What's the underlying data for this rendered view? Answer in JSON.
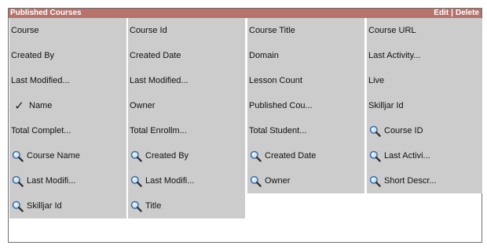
{
  "header": {
    "title": "Published Courses",
    "edit_label": "Edit",
    "separator": "|",
    "delete_label": "Delete"
  },
  "columns": [
    [
      {
        "label": "Course",
        "icon": ""
      },
      {
        "label": "Created By",
        "icon": ""
      },
      {
        "label": "Last Modified...",
        "icon": ""
      },
      {
        "label": "Name",
        "icon": "checkmark-icon"
      },
      {
        "label": "Total Complet...",
        "icon": ""
      },
      {
        "label": "Course Name",
        "icon": "search-icon"
      },
      {
        "label": "Last Modifi...",
        "icon": "search-icon"
      },
      {
        "label": "Skilljar Id",
        "icon": "search-icon"
      }
    ],
    [
      {
        "label": "Course Id",
        "icon": ""
      },
      {
        "label": "Created Date",
        "icon": ""
      },
      {
        "label": "Last Modified...",
        "icon": ""
      },
      {
        "label": "Owner",
        "icon": ""
      },
      {
        "label": "Total Enrollm...",
        "icon": ""
      },
      {
        "label": "Created By",
        "icon": "search-icon"
      },
      {
        "label": "Last Modifi...",
        "icon": "search-icon"
      },
      {
        "label": "Title",
        "icon": "search-icon"
      }
    ],
    [
      {
        "label": "Course Title",
        "icon": ""
      },
      {
        "label": "Domain",
        "icon": ""
      },
      {
        "label": "Lesson Count",
        "icon": ""
      },
      {
        "label": "Published Cou...",
        "icon": ""
      },
      {
        "label": "Total Student...",
        "icon": ""
      },
      {
        "label": "Created Date",
        "icon": "search-icon"
      },
      {
        "label": "Owner",
        "icon": "search-icon"
      }
    ],
    [
      {
        "label": "Course URL",
        "icon": ""
      },
      {
        "label": "Last Activity...",
        "icon": ""
      },
      {
        "label": "Live",
        "icon": ""
      },
      {
        "label": "Skilljar Id",
        "icon": ""
      },
      {
        "label": "Course ID",
        "icon": "search-icon"
      },
      {
        "label": "Last Activi...",
        "icon": "search-icon"
      },
      {
        "label": "Short Descr...",
        "icon": "search-icon"
      }
    ]
  ],
  "colors": {
    "header_bg": "#b6726b",
    "column_bg": "#cccccc",
    "border": "#6e6e6e"
  }
}
